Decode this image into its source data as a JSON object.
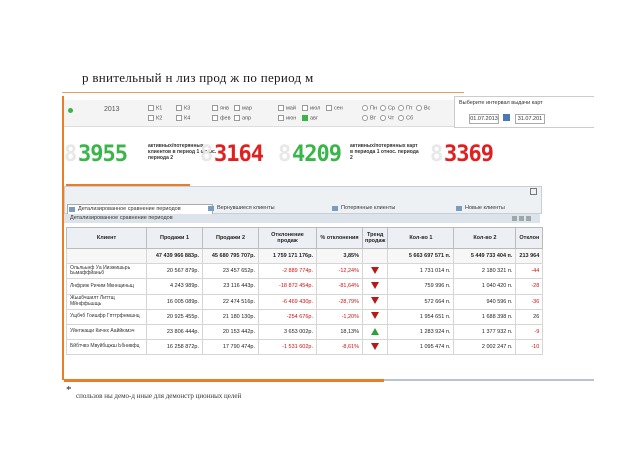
{
  "slide_title": "р внительный   н лиз прод ж по период м",
  "filters": {
    "year": "2013",
    "quarters": [
      "К1",
      "К2",
      "К3",
      "К4"
    ],
    "months": [
      "янв",
      "фев",
      "мар",
      "апр",
      "май",
      "июн",
      "июл",
      "авг",
      "сен"
    ],
    "weekdays": [
      "Пн",
      "Вт",
      "Ср",
      "Чт",
      "Пт",
      "Сб",
      "Вс"
    ]
  },
  "interval": {
    "label": "Выберите интервал выдачи карт",
    "start": "01.07.2013",
    "end": "31.07.201"
  },
  "counters": [
    {
      "value": "3955",
      "ghost": "8",
      "color": "green",
      "label": "активных/потерянных клиентов в период 1 относ. периода 2"
    },
    {
      "value": "3164",
      "ghost": "8",
      "color": "red",
      "label": ""
    },
    {
      "value": "4209",
      "ghost": "8",
      "color": "green",
      "label": "активных/потерянных карт в периода 1 относ. периода 2"
    },
    {
      "value": "3369",
      "ghost": "8",
      "color": "red",
      "label": ""
    }
  ],
  "tabs": [
    {
      "label": "Детализированное сравнение периодов",
      "active": true
    },
    {
      "label": "Вернувшиеся клиенты",
      "active": false
    },
    {
      "label": "Потерянные клиенты",
      "active": false
    },
    {
      "label": "Новые клиенты",
      "active": false
    }
  ],
  "section_title": "Детализированное сравнение периодов",
  "table": {
    "headers": [
      "Клиент",
      "Продажи 1",
      "Продажи 2",
      "Отклонение продаж",
      "% отклонения",
      "Тренд продаж",
      "Кол-во 1",
      "Кол-во 2",
      "Отклон"
    ],
    "total": [
      "",
      "47 439 966 883р.",
      "45 680 795 707р.",
      "1 759 171 176р.",
      "3,85%",
      "",
      "5 663 697 571 п.",
      "5 449 733 404 п.",
      "213 964"
    ],
    "rows": [
      {
        "client": "Ольлььнф Уа Ииэжишьрь Ььмаффйаньб",
        "s1": "20 567 879р.",
        "s2": "23 457 652р.",
        "dev": "-2 889 774р.",
        "pct": "-12,24%",
        "trend": "down",
        "q1": "1 731 014 п.",
        "q2": "2 180 321 п.",
        "qdev": "-44"
      },
      {
        "client": "Лнфриж Ричим Мкннциньщ",
        "s1": "4 243 989р.",
        "s2": "23 116 443р.",
        "dev": "-18 872 454р.",
        "pct": "-81,64%",
        "trend": "down",
        "q1": "759 996 п.",
        "q2": "1 040 420 п.",
        "qdev": "-28"
      },
      {
        "client": "Жьшбчшилт Литтщ Мйнффьшщь",
        "s1": "16 005 089р.",
        "s2": "22 474 516р.",
        "dev": "-6 469 430р.",
        "pct": "-28,79%",
        "trend": "down",
        "q1": "572 664 п.",
        "q2": "940 596 п.",
        "qdev": "-36"
      },
      {
        "client": "Ущбчб Гоишфр Гпттрфнмшнц",
        "s1": "20 925 455р.",
        "s2": "21 180 130р.",
        "dev": "-254 676р.",
        "pct": "-1,20%",
        "trend": "down",
        "q1": "1 954 651 п.",
        "q2": "1 688 398 п.",
        "qdev": "26"
      },
      {
        "client": "Уйнтжащи Кичнх Ааййюмэч",
        "s1": "23 806 444р.",
        "s2": "20 153 442р.",
        "dev": "3 653 002р.",
        "pct": "18,13%",
        "trend": "up",
        "q1": "1 283 924 п.",
        "q2": "1 377 932 п.",
        "qdev": "-9"
      },
      {
        "client": "Бйбтчвэ Мвуйбщжш Ьбнивфц",
        "s1": "16 258 872р.",
        "s2": "17 790 474р.",
        "dev": "-1 531 602р.",
        "pct": "-8,61%",
        "trend": "down",
        "q1": "1 095 474 п.",
        "q2": "2 002 247 п.",
        "qdev": "-10"
      }
    ]
  },
  "footnote_star": "*",
  "footnote": "спользов ны демо-д нные для демонстр ционных целей",
  "colors": {
    "accent": "#e87d2a",
    "green": "#3ab54a",
    "red": "#e02020"
  }
}
